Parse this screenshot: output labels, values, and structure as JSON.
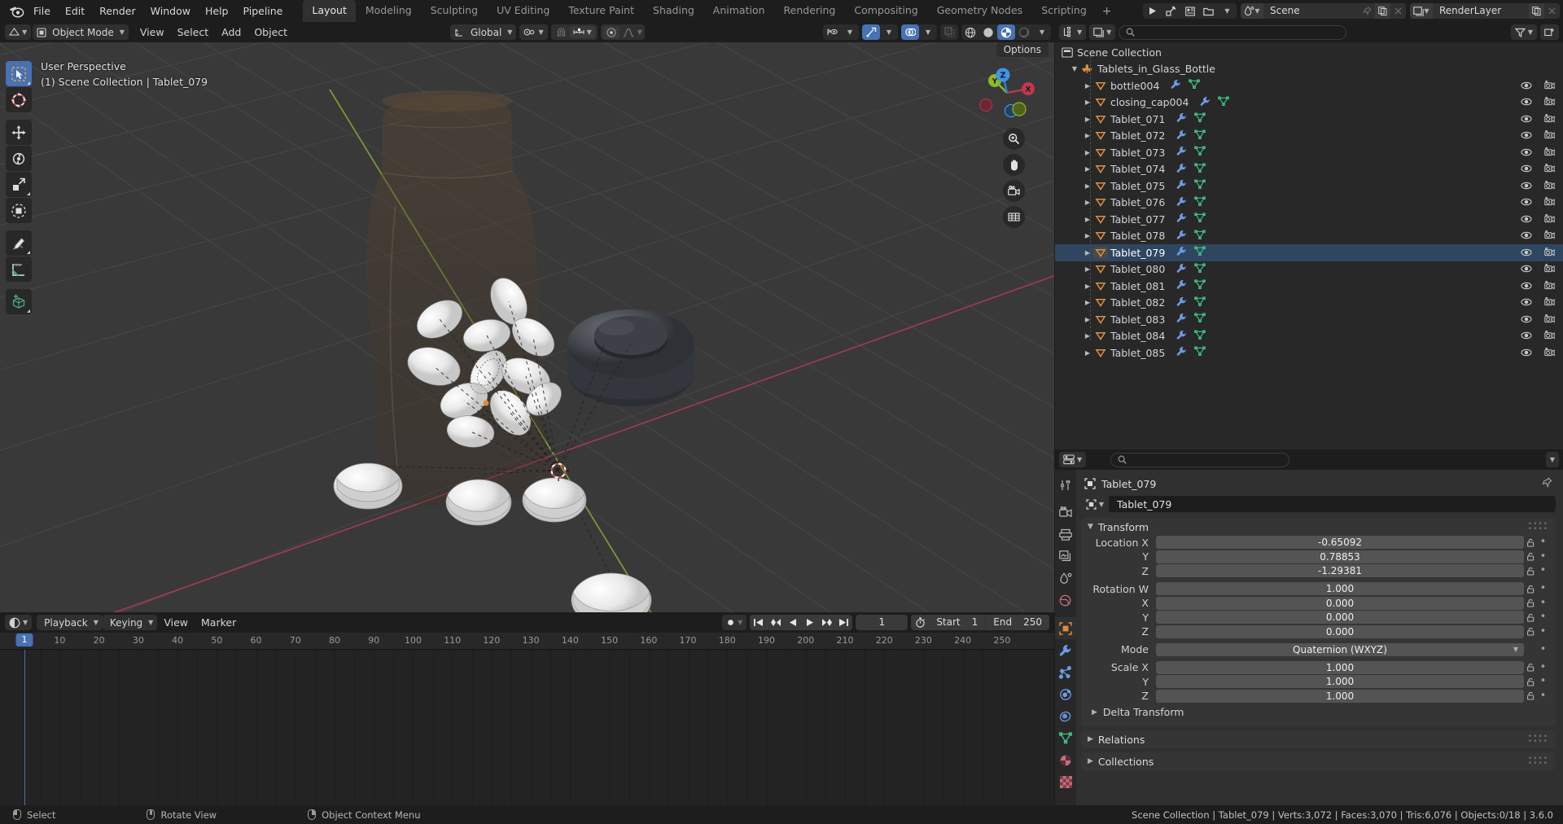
{
  "app": {
    "title": "Blender",
    "version": "3.6.0"
  },
  "topbar": {
    "menus": [
      "File",
      "Edit",
      "Render",
      "Window",
      "Help",
      "Pipeline"
    ],
    "workspaces": [
      {
        "label": "Layout",
        "active": true
      },
      {
        "label": "Modeling",
        "active": false
      },
      {
        "label": "Sculpting",
        "active": false
      },
      {
        "label": "UV Editing",
        "active": false
      },
      {
        "label": "Texture Paint",
        "active": false
      },
      {
        "label": "Shading",
        "active": false
      },
      {
        "label": "Animation",
        "active": false
      },
      {
        "label": "Rendering",
        "active": false
      },
      {
        "label": "Compositing",
        "active": false
      },
      {
        "label": "Geometry Nodes",
        "active": false
      },
      {
        "label": "Scripting",
        "active": false
      }
    ],
    "add_workspace": "+",
    "scene_name": "Scene",
    "viewlayer_name": "RenderLayer"
  },
  "viewport_header": {
    "mode": "Object Mode",
    "menus": [
      "View",
      "Select",
      "Add",
      "Object"
    ],
    "transform_orientation": "Global",
    "snap_enabled": false,
    "proportional_editing": false
  },
  "viewport": {
    "perspective_label": "User Perspective",
    "context_label": "(1) Scene Collection | Tablet_079",
    "options_label": "Options",
    "gizmo_axes": [
      "X",
      "Y",
      "Z"
    ],
    "tools": [
      "tweak-select-tool",
      "cursor-tool",
      "move-tool",
      "rotate-tool",
      "scale-tool",
      "transform-tool",
      "annotate-tool",
      "measure-tool",
      "add-cube-tool"
    ]
  },
  "timeline": {
    "editor_menus": [
      "Playback",
      "Keying",
      "View",
      "Marker"
    ],
    "current_frame": "1",
    "start_label": "Start",
    "start_value": "1",
    "end_label": "End",
    "end_value": "250",
    "ticks": [
      1,
      10,
      20,
      30,
      40,
      50,
      60,
      70,
      80,
      90,
      100,
      110,
      120,
      130,
      140,
      150,
      160,
      170,
      180,
      190,
      200,
      210,
      220,
      230,
      240,
      250
    ],
    "range_min": 1,
    "range_max": 255
  },
  "outliner": {
    "scene_collection": "Scene Collection",
    "collection": "Tablets_in_Glass_Bottle",
    "items": [
      {
        "name": "bottle004",
        "selected": false
      },
      {
        "name": "closing_cap004",
        "selected": false
      },
      {
        "name": "Tablet_071",
        "selected": false
      },
      {
        "name": "Tablet_072",
        "selected": false
      },
      {
        "name": "Tablet_073",
        "selected": false
      },
      {
        "name": "Tablet_074",
        "selected": false
      },
      {
        "name": "Tablet_075",
        "selected": false
      },
      {
        "name": "Tablet_076",
        "selected": false
      },
      {
        "name": "Tablet_077",
        "selected": false
      },
      {
        "name": "Tablet_078",
        "selected": false
      },
      {
        "name": "Tablet_079",
        "selected": true
      },
      {
        "name": "Tablet_080",
        "selected": false
      },
      {
        "name": "Tablet_081",
        "selected": false
      },
      {
        "name": "Tablet_082",
        "selected": false
      },
      {
        "name": "Tablet_083",
        "selected": false
      },
      {
        "name": "Tablet_084",
        "selected": false
      },
      {
        "name": "Tablet_085",
        "selected": false
      }
    ]
  },
  "properties": {
    "breadcrumb_object": "Tablet_079",
    "id_name": "Tablet_079",
    "transform": {
      "title": "Transform",
      "rows": [
        {
          "label": "Location X",
          "value": "-0.65092",
          "gap": false
        },
        {
          "label": "Y",
          "value": "0.78853",
          "gap": false
        },
        {
          "label": "Z",
          "value": "-1.29381",
          "gap": false
        },
        {
          "label": "Rotation W",
          "value": "1.000",
          "gap": true
        },
        {
          "label": "X",
          "value": "0.000",
          "gap": false
        },
        {
          "label": "Y",
          "value": "0.000",
          "gap": false
        },
        {
          "label": "Z",
          "value": "0.000",
          "gap": false
        }
      ],
      "mode_label": "Mode",
      "mode_value": "Quaternion (WXYZ)",
      "scale_rows": [
        {
          "label": "Scale X",
          "value": "1.000",
          "gap": true
        },
        {
          "label": "Y",
          "value": "1.000",
          "gap": false
        },
        {
          "label": "Z",
          "value": "1.000",
          "gap": false
        }
      ],
      "delta_transform": "Delta Transform"
    },
    "closed_panels": [
      "Relations",
      "Collections"
    ],
    "tabs": [
      "tool-tab",
      "render-tab",
      "output-tab",
      "viewlayer-tab",
      "scene-tab",
      "world-tab",
      "object-tab",
      "modifiers-tab",
      "particles-tab",
      "physics-tab",
      "constraints-tab",
      "data-tab",
      "material-tab",
      "texture-tab"
    ]
  },
  "statusbar": {
    "hints": [
      {
        "mouse": "left",
        "label": "Select"
      },
      {
        "mouse": "mid",
        "label": "Rotate View"
      },
      {
        "mouse": "right",
        "label": "Object Context Menu"
      }
    ],
    "info": "Scene Collection | Tablet_079 | Verts:3,072 | Faces:3,070 | Tris:6,076 | Objects:0/18 | 3.6.0"
  },
  "colors": {
    "accent": "#4772b3",
    "panel_bg": "#303030",
    "outliner_bg": "#282828",
    "viewport_bg": "#393939",
    "mesh_orange": "#e08a3c",
    "mesh_green": "#3fc48a",
    "modifier_blue": "#6b9ae8",
    "axis_x": "#c0384d",
    "axis_y": "#8bb72a",
    "axis_z": "#2f7fd4"
  }
}
